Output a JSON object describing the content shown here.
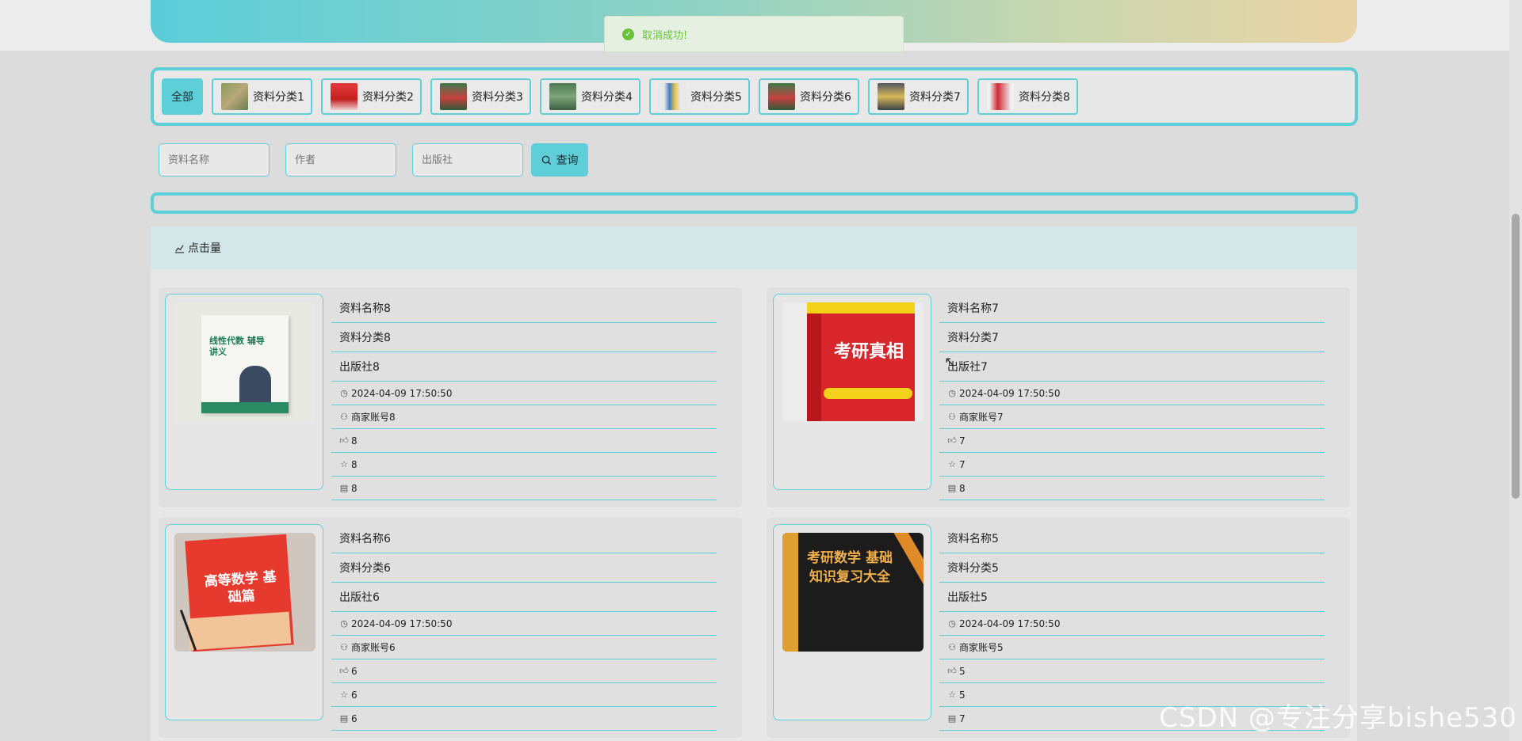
{
  "toast": {
    "message": "取消成功!",
    "icon": "check-circle-icon",
    "color": "#67c23a"
  },
  "colors": {
    "accent": "#5ecfd9",
    "banner_start": "#5bcdd8",
    "banner_end": "#ead4a6"
  },
  "categories": {
    "all_label": "全部",
    "items": [
      {
        "label": "资料分类1"
      },
      {
        "label": "资料分类2"
      },
      {
        "label": "资料分类3"
      },
      {
        "label": "资料分类4"
      },
      {
        "label": "资料分类5"
      },
      {
        "label": "资料分类6"
      },
      {
        "label": "资料分类7"
      },
      {
        "label": "资料分类8"
      }
    ]
  },
  "search": {
    "name_placeholder": "资料名称",
    "author_placeholder": "作者",
    "publisher_placeholder": "出版社",
    "button_label": "查询"
  },
  "section": {
    "title": "点击量",
    "icon": "chart-icon"
  },
  "cards": [
    {
      "name": "资料名称8",
      "category": "资料分类8",
      "publisher": "出版社8",
      "time": "2024-04-09 17:50:50",
      "merchant": "商家账号8",
      "likes": "8",
      "favorites": "8",
      "comments": "8",
      "cover_text": "线性代数 辅导讲义"
    },
    {
      "name": "资料名称7",
      "category": "资料分类7",
      "publisher": "出版社7",
      "time": "2024-04-09 17:50:50",
      "merchant": "商家账号7",
      "likes": "7",
      "favorites": "7",
      "comments": "8",
      "cover_text": "考研真相"
    },
    {
      "name": "资料名称6",
      "category": "资料分类6",
      "publisher": "出版社6",
      "time": "2024-04-09 17:50:50",
      "merchant": "商家账号6",
      "likes": "6",
      "favorites": "6",
      "comments": "6",
      "cover_text": "高等数学 基础篇"
    },
    {
      "name": "资料名称5",
      "category": "资料分类5",
      "publisher": "出版社5",
      "time": "2024-04-09 17:50:50",
      "merchant": "商家账号5",
      "likes": "5",
      "favorites": "5",
      "comments": "7",
      "cover_text": "考研数学 基础知识复习大全"
    }
  ],
  "watermark": "CSDN @专注分享bishe530"
}
